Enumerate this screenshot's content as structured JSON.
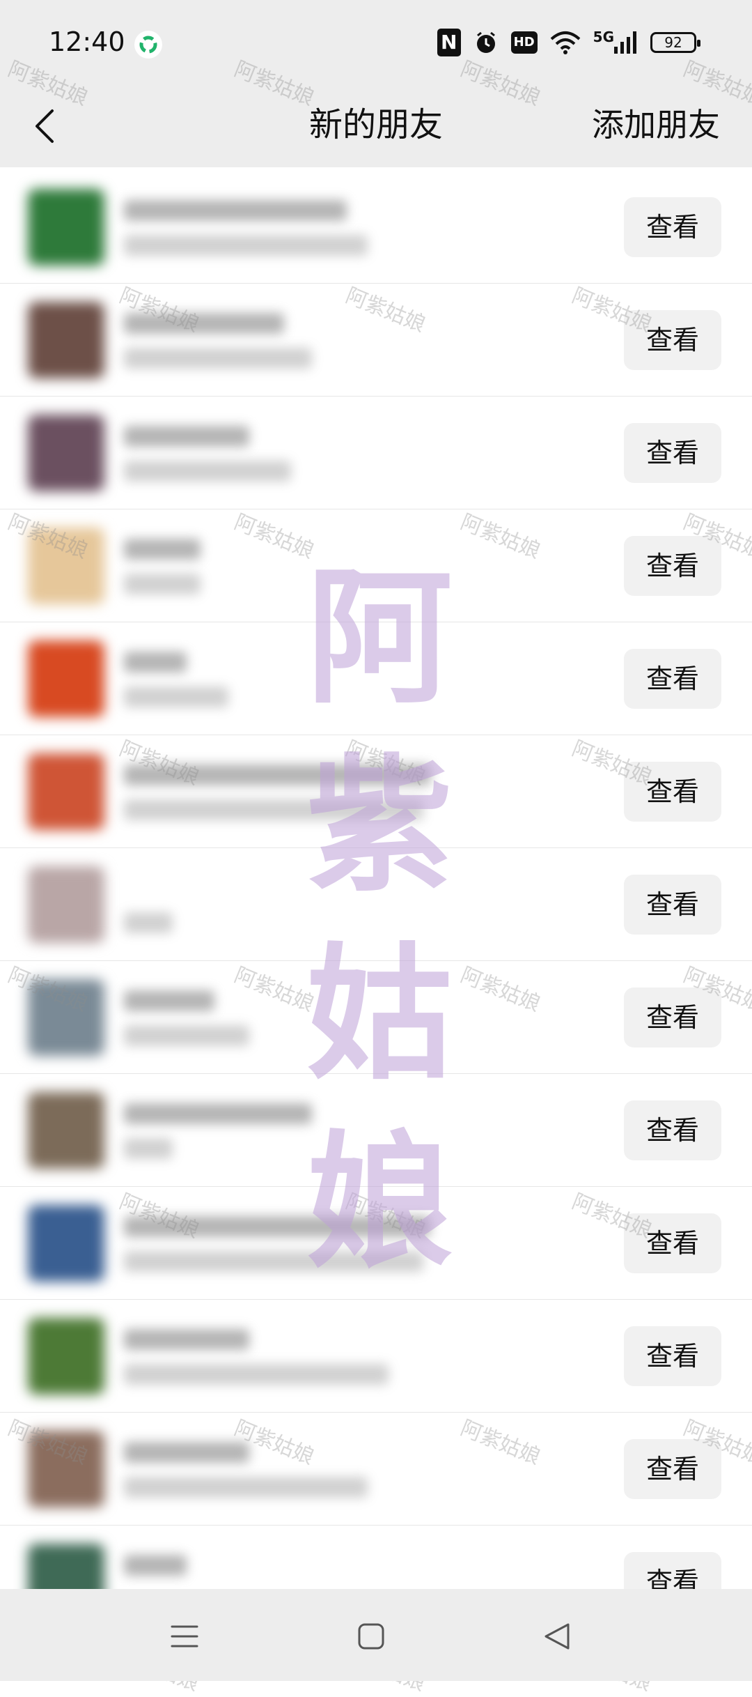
{
  "status_bar": {
    "time": "12:40",
    "battery": "92",
    "network": "5G",
    "hd": "HD",
    "nfc": "N"
  },
  "header": {
    "title": "新的朋友",
    "action": "添加朋友"
  },
  "rows": [
    {
      "action": "查看",
      "avatar_color": "#2e7a3a"
    },
    {
      "action": "查看",
      "avatar_color": "#6d5048"
    },
    {
      "action": "查看",
      "avatar_color": "#6b5060"
    },
    {
      "action": "查看",
      "avatar_color": "#e6c79a"
    },
    {
      "action": "查看",
      "avatar_color": "#d84a22"
    },
    {
      "action": "查看",
      "avatar_color": "#cf5536"
    },
    {
      "action": "查看",
      "avatar_color": "#b9a6a6"
    },
    {
      "action": "查看",
      "avatar_color": "#7a8a96"
    },
    {
      "action": "查看",
      "avatar_color": "#7c6b59"
    },
    {
      "action": "查看",
      "avatar_color": "#3a5f92"
    },
    {
      "action": "查看",
      "avatar_color": "#4d7a36"
    },
    {
      "action": "查看",
      "avatar_color": "#8b6d5e"
    },
    {
      "action": "查看",
      "avatar_color": "#3f6a56"
    }
  ],
  "watermark": {
    "text": "阿紫姑娘",
    "big": [
      "阿",
      "紫",
      "姑",
      "娘"
    ]
  },
  "nav": {
    "icons": [
      "menu-icon",
      "home-icon",
      "back-triangle-icon"
    ]
  }
}
